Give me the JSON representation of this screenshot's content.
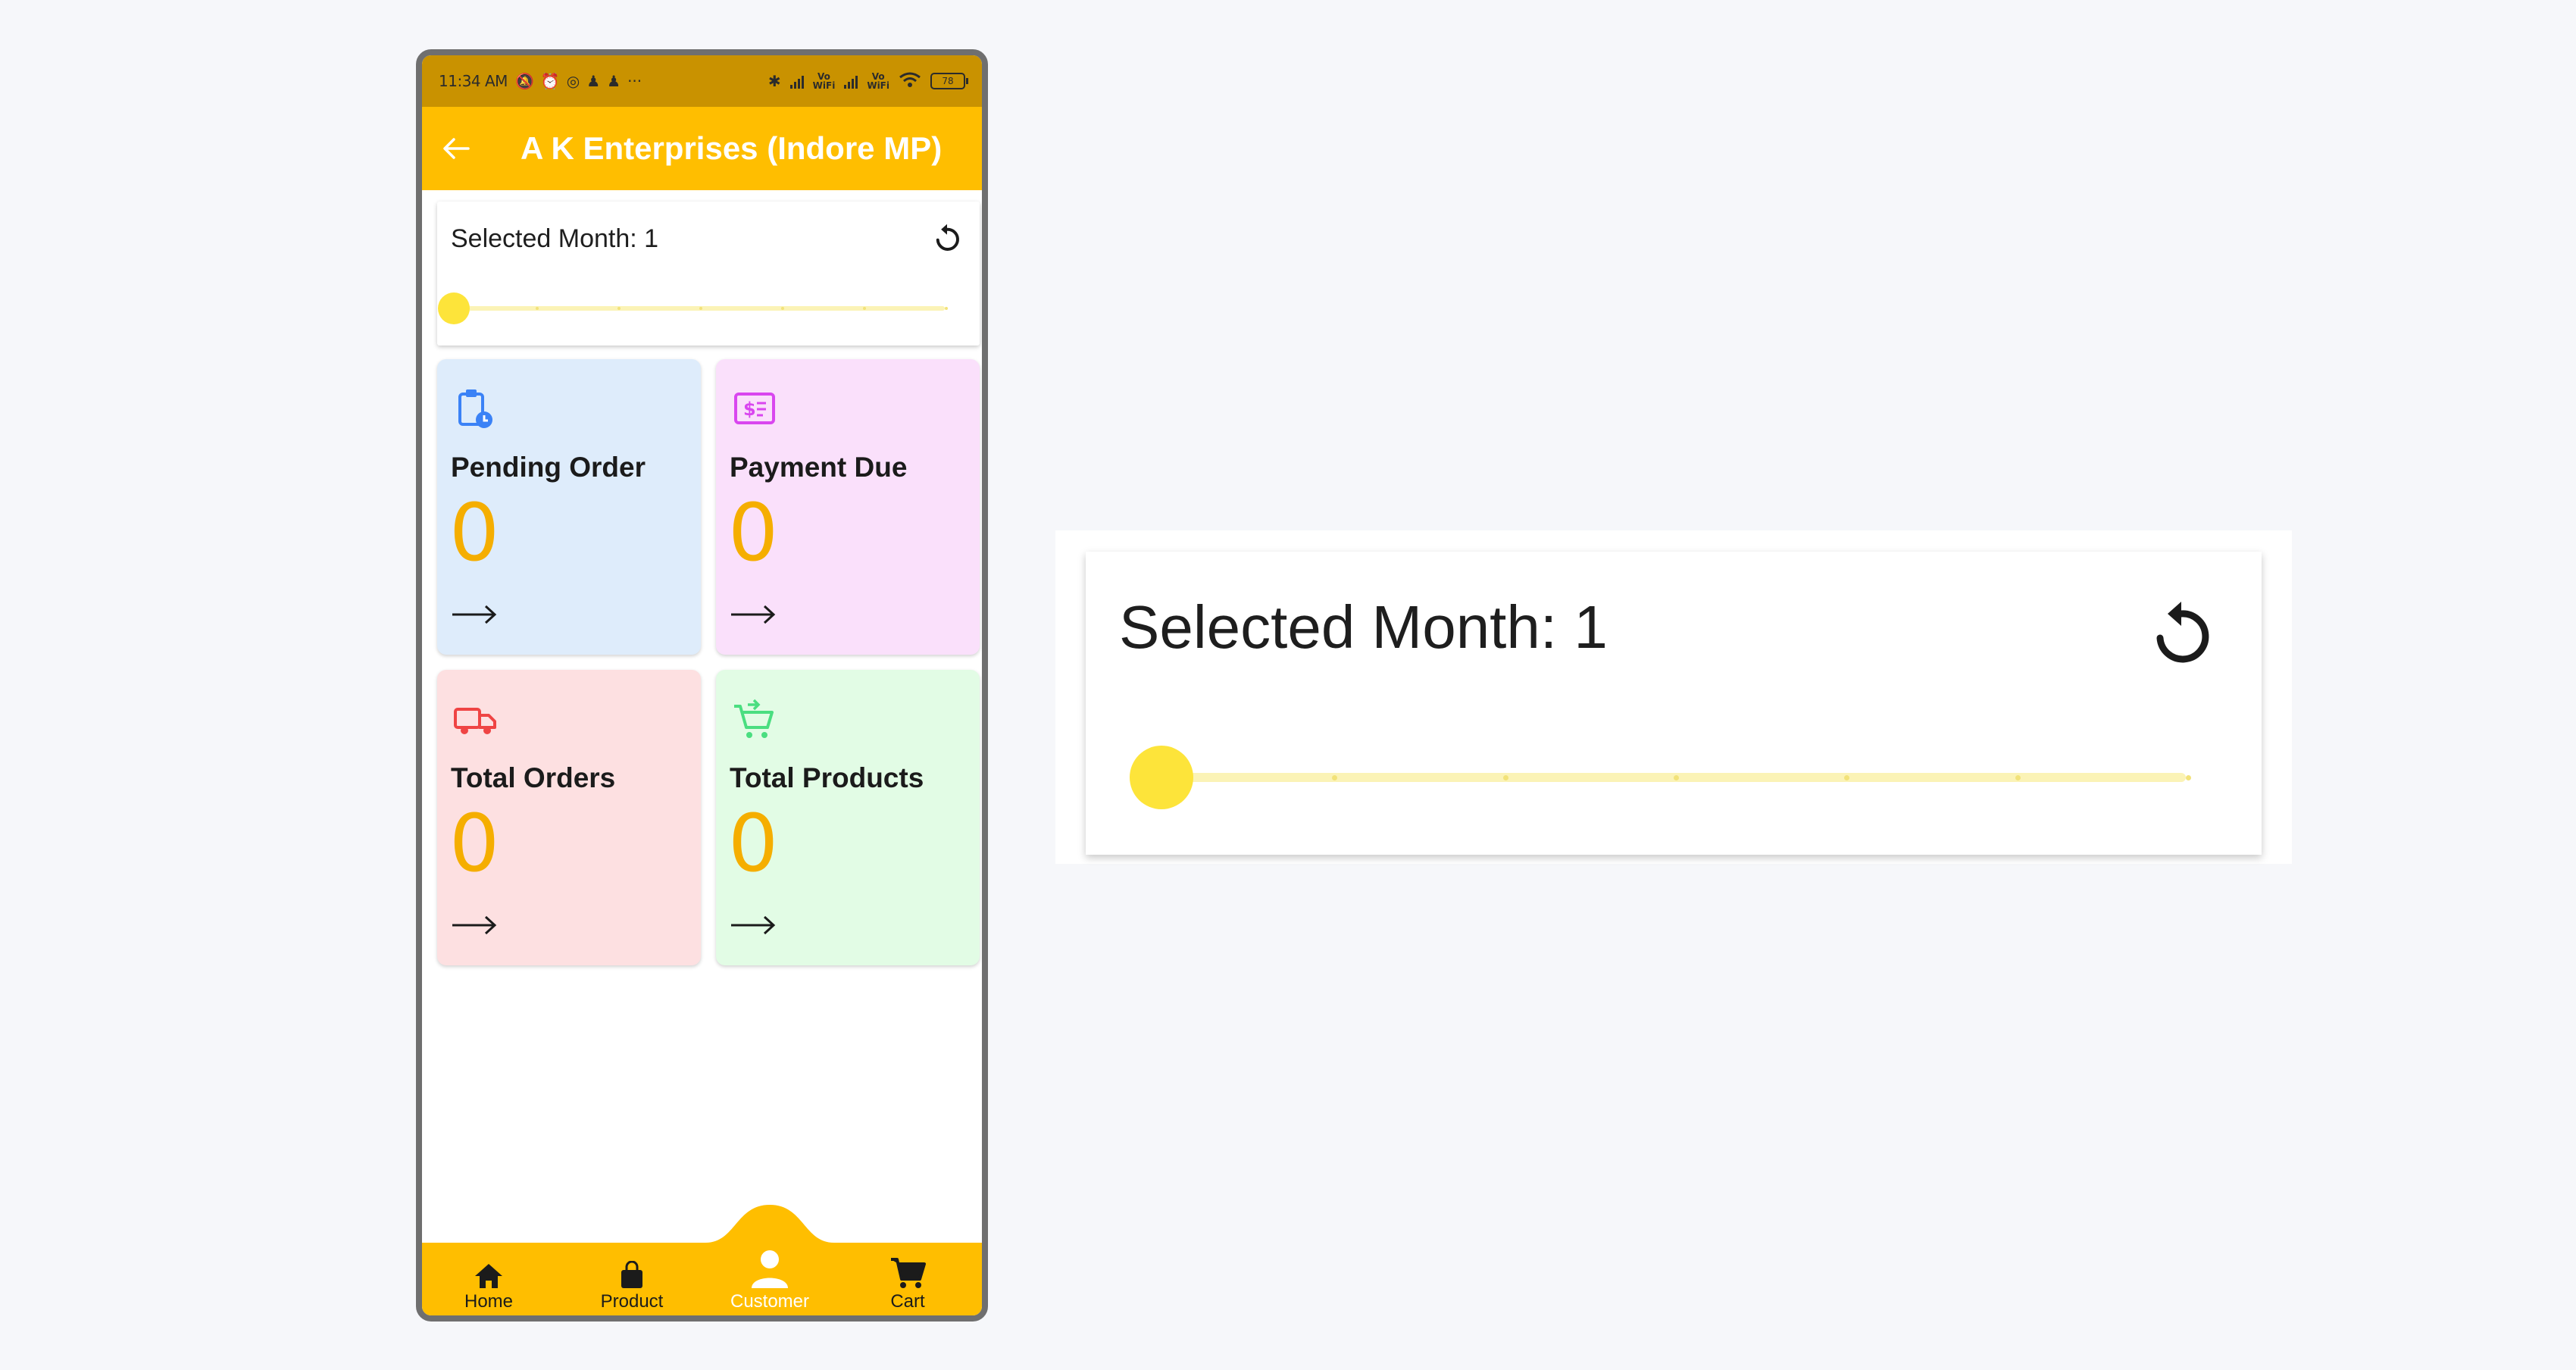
{
  "status_bar": {
    "time": "11:34 AM",
    "vowifi_1": "Vo\nWiFi",
    "vowifi_2": "Vo\nWiFi",
    "battery": "78"
  },
  "app_bar": {
    "title": "A K Enterprises (Indore MP)"
  },
  "month_selector": {
    "label": "Selected Month: 1",
    "value": 1,
    "min": 1,
    "max": 12,
    "fraction": 0.0
  },
  "tiles": [
    {
      "label": "Pending Order",
      "value": "0",
      "icon": "clipboard-clock-icon",
      "bg": "#deecfb",
      "icon_color": "#3b82f6"
    },
    {
      "label": "Payment Due",
      "value": "0",
      "icon": "payment-bill-icon",
      "bg": "#fae0fb",
      "icon_color": "#d946ef"
    },
    {
      "label": "Total Orders",
      "value": "0",
      "icon": "truck-icon",
      "bg": "#fde0e1",
      "icon_color": "#ef4444"
    },
    {
      "label": "Total Products",
      "value": "0",
      "icon": "cart-add-icon",
      "bg": "#e2fce5",
      "icon_color": "#4ade80"
    }
  ],
  "bottom_nav": [
    {
      "label": "Home",
      "icon": "home-icon"
    },
    {
      "label": "Product",
      "icon": "bag-icon"
    },
    {
      "label": "Customer",
      "icon": "person-icon",
      "active": true
    },
    {
      "label": "Cart",
      "icon": "cart-icon"
    }
  ],
  "zoom": {
    "label": "Selected Month: 1"
  },
  "colors": {
    "primary": "#ffbe00",
    "status_bar": "#c99200",
    "value_orange": "#f5ae00",
    "slider_thumb": "#fde43a",
    "slider_track": "#fbf3b6"
  }
}
